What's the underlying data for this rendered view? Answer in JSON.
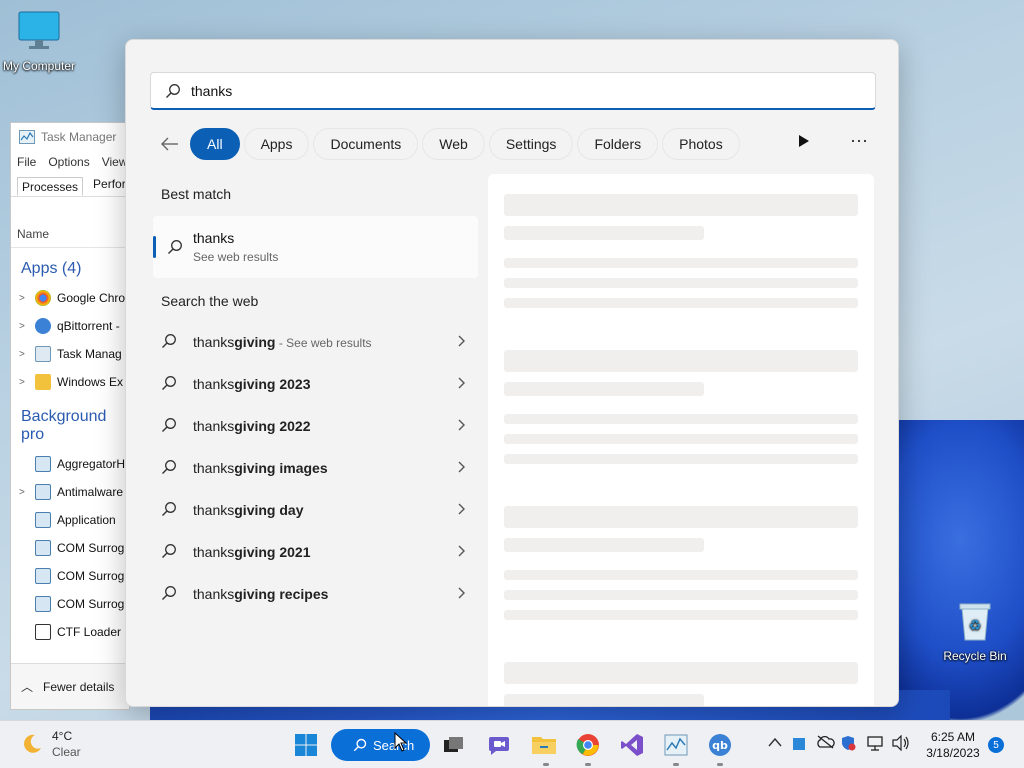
{
  "desktop": {
    "icons": [
      {
        "label": "My Computer",
        "icon": "monitor-icon"
      },
      {
        "label": "Recycle Bin",
        "icon": "recycle-bin-icon"
      }
    ]
  },
  "task_manager": {
    "title": "Task Manager",
    "menu": [
      "File",
      "Options",
      "View"
    ],
    "tabs": [
      "Processes",
      "Perform"
    ],
    "column": "Name",
    "apps_group": "Apps (4)",
    "apps": [
      "Google Chro",
      "qBittorrent -",
      "Task Manag",
      "Windows Ex"
    ],
    "bg_group": "Background pro",
    "bg_processes": [
      "AggregatorH",
      "Antimalware",
      "Application",
      "COM Surrog",
      "COM Surrog",
      "COM Surrog",
      "CTF Loader"
    ],
    "footer": "Fewer details"
  },
  "search": {
    "query": "thanks",
    "filters": [
      "All",
      "Apps",
      "Documents",
      "Web",
      "Settings",
      "Folders",
      "Photos"
    ],
    "active_filter": "All",
    "best_match_heading": "Best match",
    "best_match": {
      "title": "thanks",
      "subtitle": "See web results"
    },
    "web_heading": "Search the web",
    "suggestions": [
      {
        "prefix": "thanks",
        "bold": "giving",
        "hint": " - See web results"
      },
      {
        "prefix": "thanks",
        "bold": "giving 2023",
        "hint": ""
      },
      {
        "prefix": "thanks",
        "bold": "giving 2022",
        "hint": ""
      },
      {
        "prefix": "thanks",
        "bold": "giving images",
        "hint": ""
      },
      {
        "prefix": "thanks",
        "bold": "giving day",
        "hint": ""
      },
      {
        "prefix": "thanks",
        "bold": "giving 2021",
        "hint": ""
      },
      {
        "prefix": "thanks",
        "bold": "giving recipes",
        "hint": ""
      }
    ]
  },
  "taskbar": {
    "weather_temp": "4°C",
    "weather_desc": "Clear",
    "search_label": "Search",
    "time": "6:25 AM",
    "date": "3/18/2023",
    "notification_count": "5"
  },
  "colors": {
    "accent": "#0b5fb5",
    "taskbar_search": "#0b6fd8"
  }
}
